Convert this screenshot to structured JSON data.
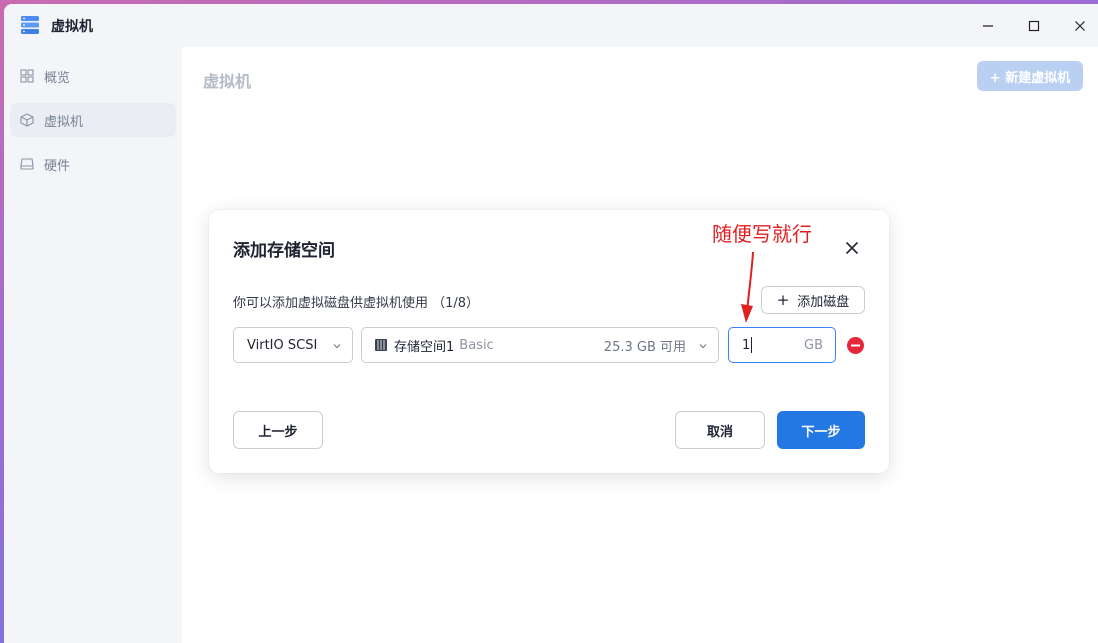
{
  "app": {
    "title": "虚拟机"
  },
  "window_controls": {
    "minimize": "—",
    "maximize": "☐",
    "close": "✕"
  },
  "sidebar": {
    "items": [
      {
        "label": "概览",
        "icon": "grid-icon",
        "active": false
      },
      {
        "label": "虚拟机",
        "icon": "cube-icon",
        "active": true
      },
      {
        "label": "硬件",
        "icon": "drive-icon",
        "active": false
      }
    ]
  },
  "main": {
    "title": "虚拟机",
    "new_vm_label": "+ 新建虚拟机"
  },
  "dialog": {
    "title": "添加存储空间",
    "description": "你可以添加虚拟磁盘供虚拟机使用 （1/8）",
    "add_disk_label": "添加磁盘",
    "disk": {
      "controller": "VirtIO SCSI",
      "storage_name": "存储空间1",
      "storage_type": "Basic",
      "available": "25.3 GB 可用",
      "size_value": "1",
      "size_unit": "GB"
    },
    "prev_label": "上一步",
    "cancel_label": "取消",
    "next_label": "下一步"
  },
  "annotation": {
    "text": "随便写就行",
    "color": "#e02020"
  },
  "colors": {
    "primary": "#2478e4",
    "danger": "#e5283a",
    "focus": "#3b82f6"
  }
}
